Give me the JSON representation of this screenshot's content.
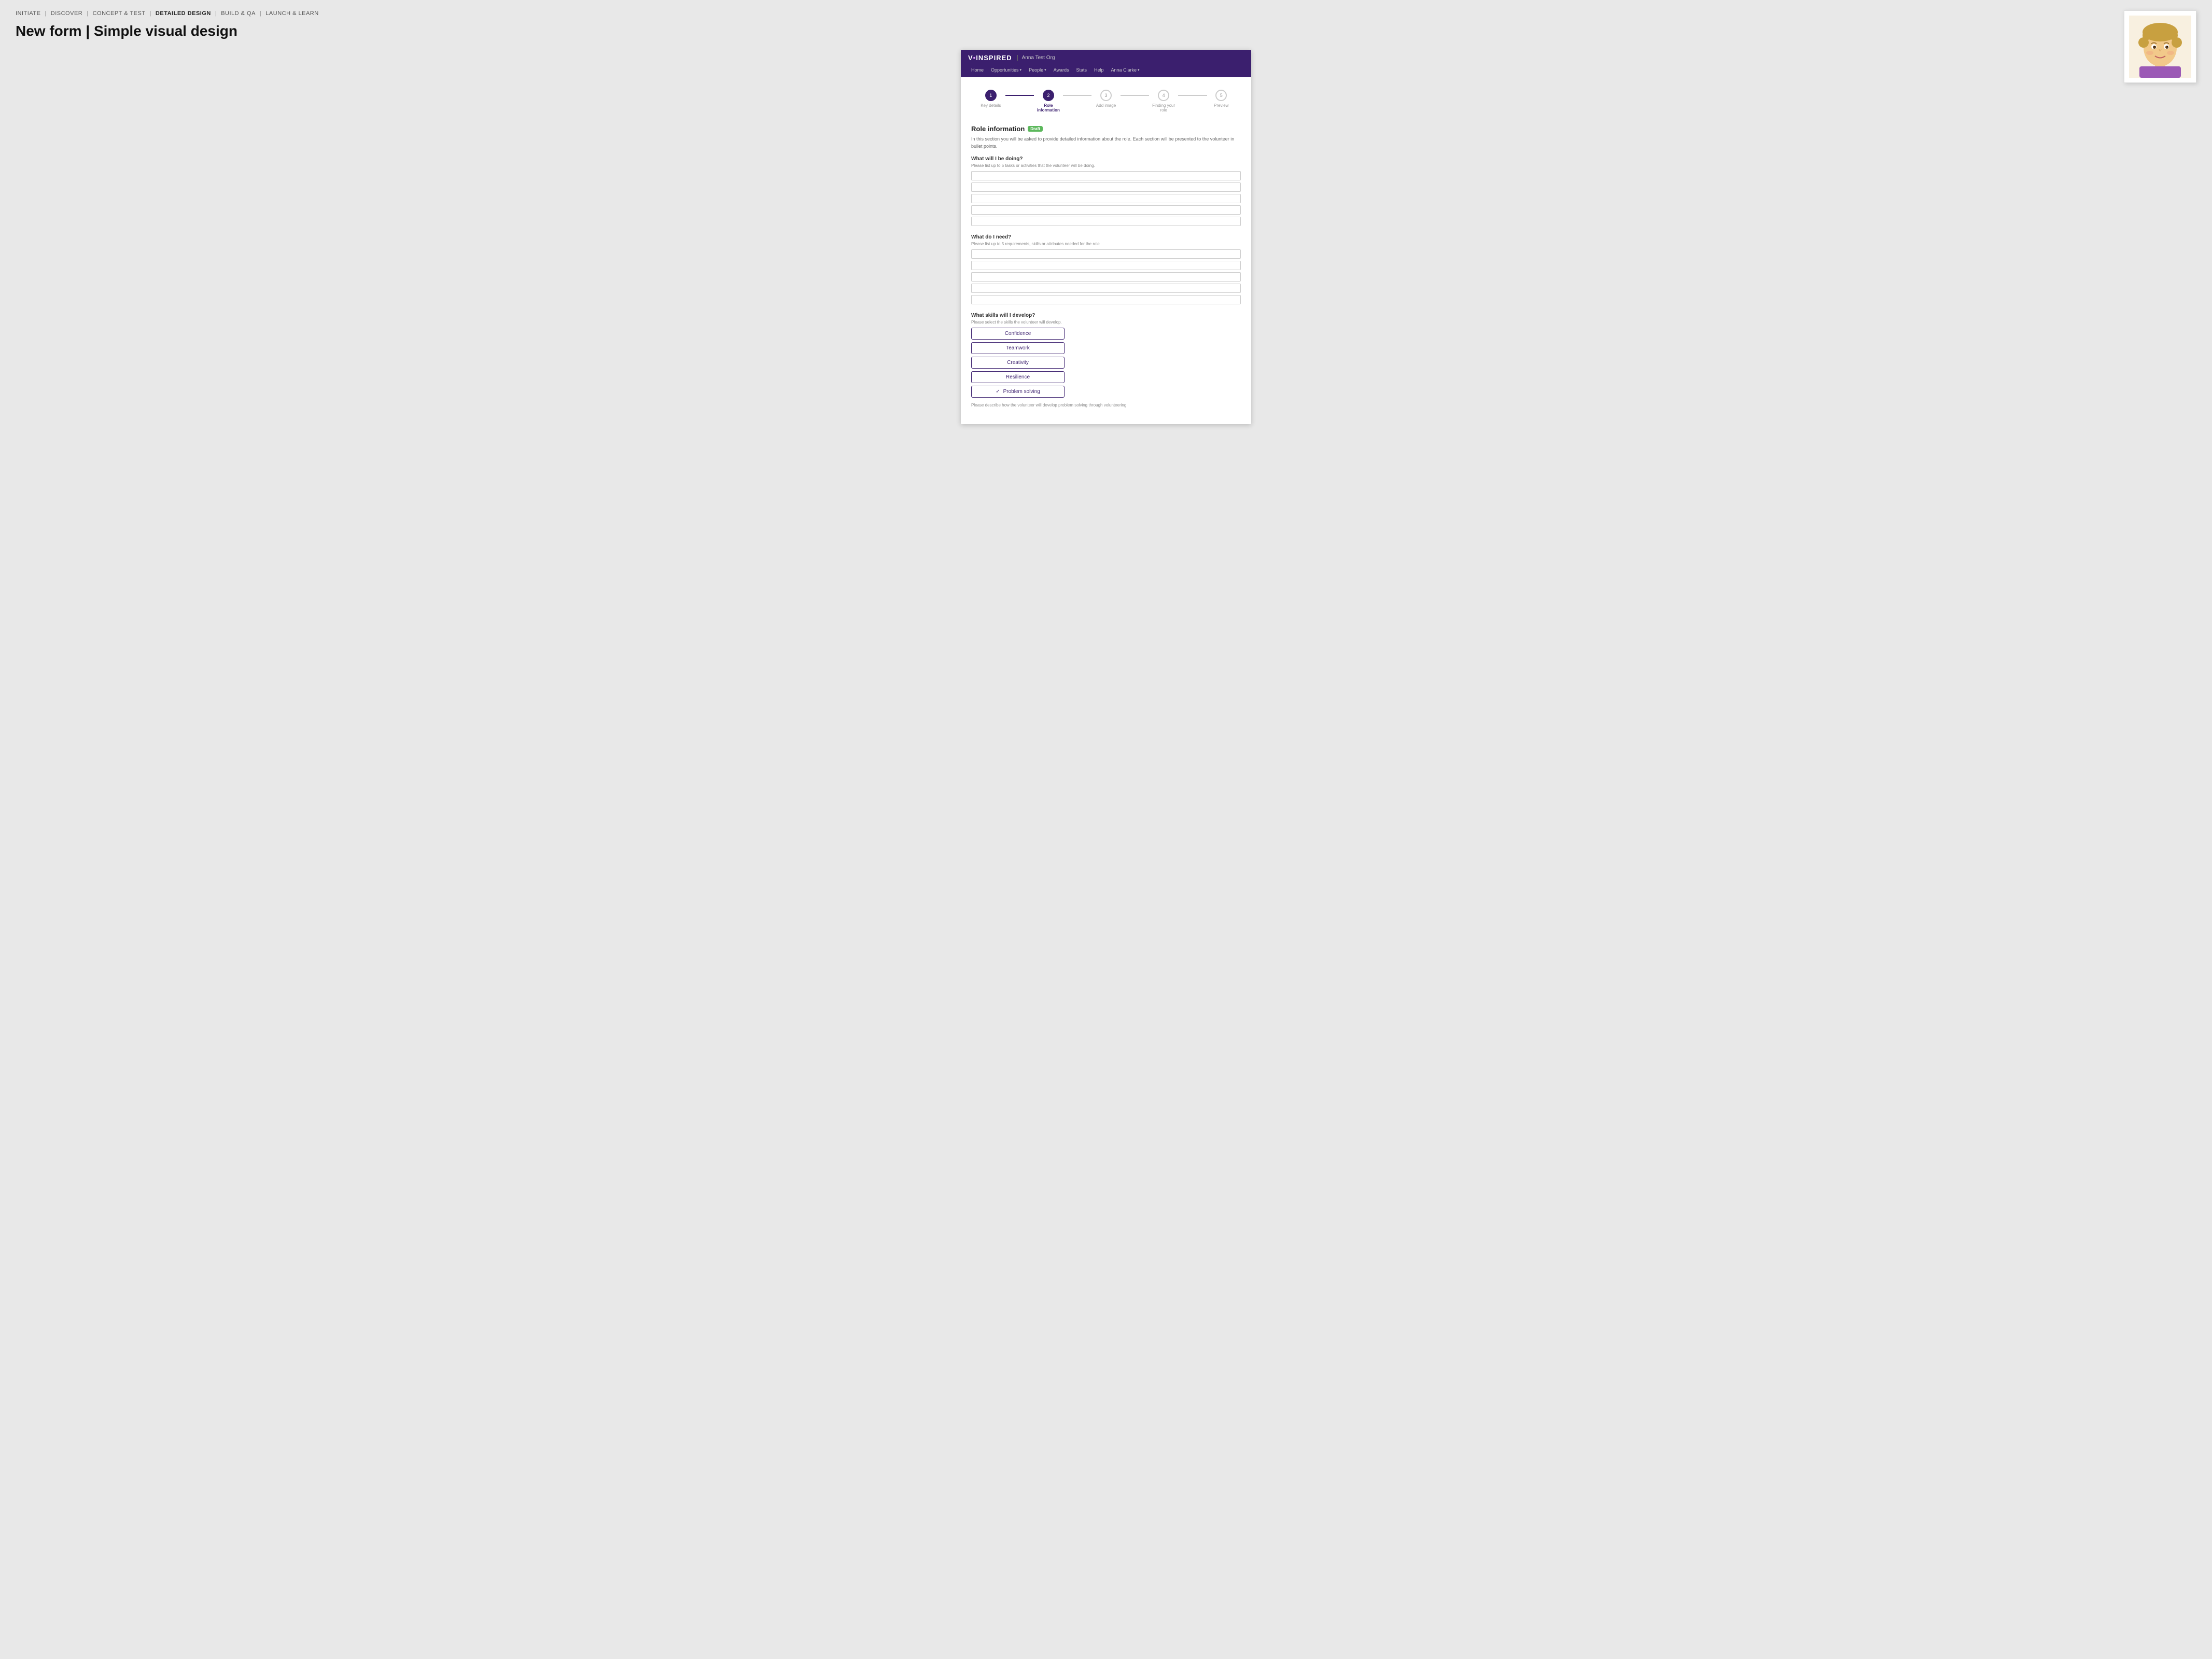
{
  "breadcrumb": {
    "items": [
      {
        "label": "INITIATE",
        "active": false
      },
      {
        "label": "DISCOVER",
        "active": false
      },
      {
        "label": "CONCEPT & TEST",
        "active": false
      },
      {
        "label": "DETAILED DESIGN",
        "active": true
      },
      {
        "label": "BUILD & QA",
        "active": false
      },
      {
        "label": "LAUNCH & LEARN",
        "active": false
      }
    ]
  },
  "page_title": "New form  |  Simple visual design",
  "nav": {
    "logo": "V•INSPIRED",
    "org": "Anna Test Org",
    "links": [
      {
        "label": "Home"
      },
      {
        "label": "Opportunities",
        "has_arrow": true
      },
      {
        "label": "People",
        "has_arrow": true
      },
      {
        "label": "Awards"
      },
      {
        "label": "Stats"
      },
      {
        "label": "Help"
      },
      {
        "label": "Anna Clarke",
        "has_arrow": true
      }
    ]
  },
  "stepper": {
    "steps": [
      {
        "number": "1",
        "label": "Key details",
        "state": "done"
      },
      {
        "number": "2",
        "label": "Role information",
        "state": "active"
      },
      {
        "number": "3",
        "label": "Add image",
        "state": "default"
      },
      {
        "number": "4",
        "label": "Finding your role",
        "state": "default"
      },
      {
        "number": "5",
        "label": "Preview",
        "state": "default"
      }
    ]
  },
  "form": {
    "section_title": "Role information",
    "badge": "Draft",
    "section_desc": "In this section you will be asked to provide detailed information about the role. Each section will be presented to the volunteer in bullet points.",
    "questions": [
      {
        "id": "what_doing",
        "label": "What will I be doing?",
        "hint": "Please list up to 5 tasks or activities that the volunteer will be doing.",
        "inputs": 5
      },
      {
        "id": "what_need",
        "label": "What do I need?",
        "hint": "Please list up to 5 requirements, skills or attributes needed for the role",
        "inputs": 5
      },
      {
        "id": "skills",
        "label": "What skills will I develop?",
        "hint": "Please select the skills the volunteer will develop.",
        "skills": [
          {
            "label": "Confidence",
            "selected": false
          },
          {
            "label": "Teamwork",
            "selected": false
          },
          {
            "label": "Creativity",
            "selected": false
          },
          {
            "label": "Resilience",
            "selected": false
          },
          {
            "label": "Problem solving",
            "selected": true
          }
        ]
      }
    ],
    "skills_followup": "Please describe how the volunteer will develop problem solving through volunteering"
  }
}
